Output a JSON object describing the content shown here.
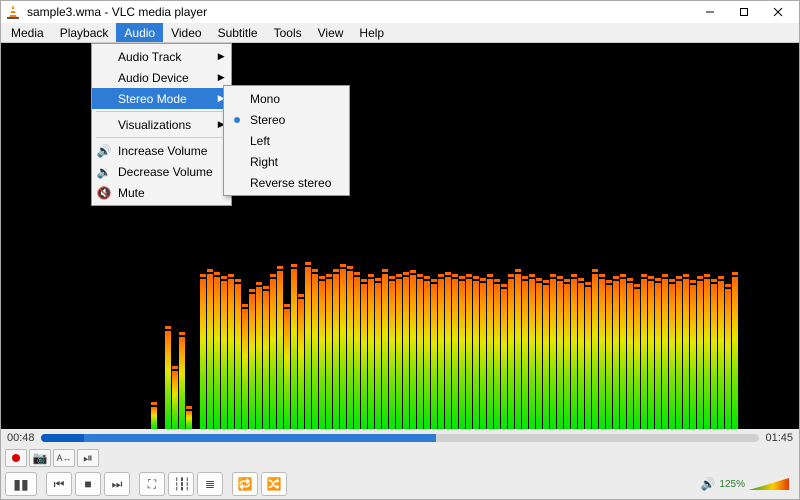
{
  "titlebar": {
    "title": "sample3.wma - VLC media player"
  },
  "menubar": {
    "items": [
      "Media",
      "Playback",
      "Audio",
      "Video",
      "Subtitle",
      "Tools",
      "View",
      "Help"
    ],
    "active_index": 2
  },
  "audio_menu": {
    "items": [
      {
        "label": "Audio Track",
        "sub": true
      },
      {
        "label": "Audio Device",
        "sub": true
      },
      {
        "label": "Stereo Mode",
        "sub": true,
        "hl": true
      },
      {
        "sep": true
      },
      {
        "label": "Visualizations",
        "sub": true
      },
      {
        "sep": true
      },
      {
        "label": "Increase Volume",
        "icon": "vol-up"
      },
      {
        "label": "Decrease Volume",
        "icon": "vol-down"
      },
      {
        "label": "Mute",
        "icon": "mute"
      }
    ]
  },
  "stereo_submenu": {
    "items": [
      {
        "label": "Mono"
      },
      {
        "label": "Stereo",
        "selected": true
      },
      {
        "label": "Left"
      },
      {
        "label": "Right"
      },
      {
        "label": "Reverse stereo"
      }
    ]
  },
  "time": {
    "elapsed": "00:48",
    "total": "01:45"
  },
  "volume": {
    "pct": "125%"
  },
  "chart_data": {
    "type": "bar",
    "title": "spectrum visualizer",
    "xlabel": "",
    "ylabel": "",
    "ylim": [
      0,
      180
    ],
    "values": [
      22,
      0,
      98,
      58,
      92,
      18,
      0,
      150,
      155,
      152,
      148,
      150,
      145,
      120,
      135,
      142,
      138,
      150,
      158,
      120,
      160,
      130,
      162,
      155,
      148,
      150,
      155,
      160,
      158,
      152,
      145,
      150,
      146,
      155,
      148,
      150,
      152,
      154,
      150,
      148,
      145,
      150,
      152,
      150,
      148,
      150,
      148,
      146,
      150,
      145,
      140,
      150,
      155,
      148,
      150,
      146,
      144,
      150,
      148,
      145,
      150,
      146,
      142,
      155,
      150,
      144,
      148,
      150,
      146,
      140,
      150,
      148,
      146,
      150,
      145,
      148,
      150,
      144,
      148,
      150,
      145,
      148,
      140,
      152
    ]
  }
}
